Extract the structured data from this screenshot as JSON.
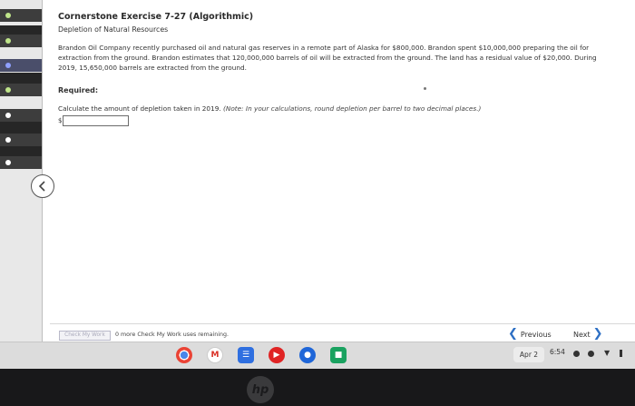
{
  "question": {
    "title": "Cornerstone Exercise 7-27 (Algorithmic)",
    "subtitle": "Depletion of Natural Resources",
    "body_lines": [
      "Brandon Oil Company recently purchased oil and natural gas reserves in a remote part of Alaska for $800,000. Brandon spent $10,000,000 preparing the oil for",
      "extraction from the ground. Brandon estimates that 120,000,000 barrels of oil will be extracted from the ground. The land has a residual value of $20,000. During",
      "2019, 15,650,000 barrels are extracted from the ground."
    ],
    "required_label": "Required:",
    "calc_prompt": "Calculate the amount of depletion taken in 2019.",
    "calc_note": "(Note: In your calculations, round depletion per barrel to two decimal places.)",
    "currency_symbol": "$",
    "answer_value": ""
  },
  "footer": {
    "check_button": "Check My Work",
    "check_note": "0 more Check My Work uses remaining.",
    "previous_label": "Previous",
    "next_label": "Next"
  },
  "taskbar": {
    "date": "Apr 2",
    "time": "6:54",
    "apps": [
      "chrome-icon",
      "gmail-icon",
      "docs-icon",
      "youtube-icon",
      "chat-icon",
      "meet-icon"
    ]
  },
  "colors": {
    "accent": "#2d6fc4",
    "sidebar_done": "#bfe58a",
    "sidebar_active": "#8fa0ff"
  }
}
